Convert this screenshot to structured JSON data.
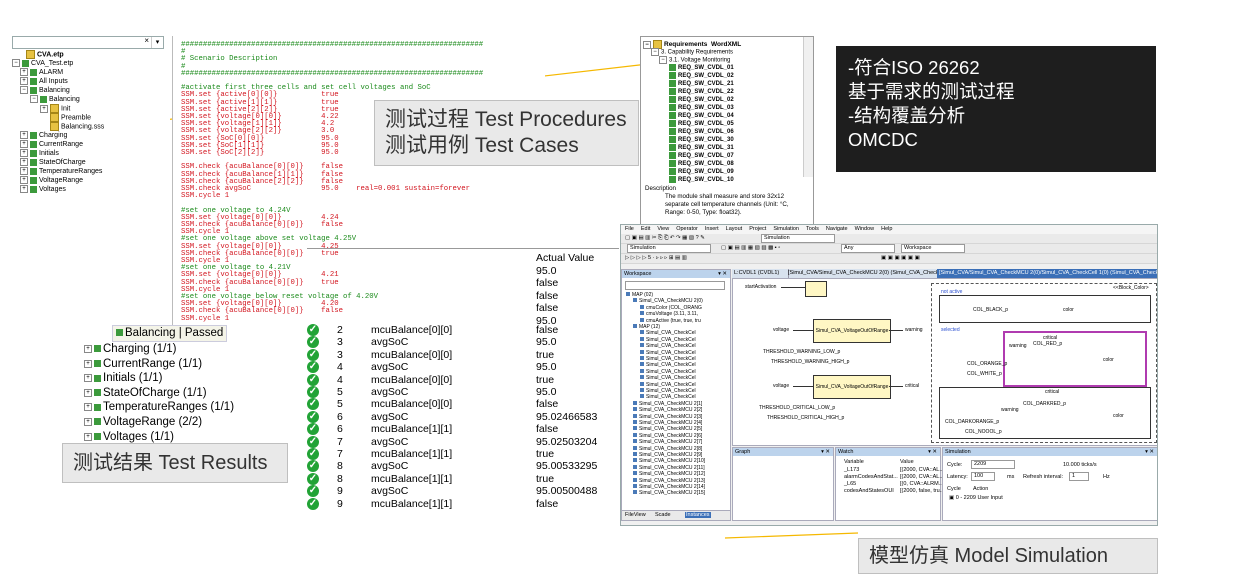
{
  "project_tree": {
    "root": "CVA.etp",
    "test_file": "CVA_Test.etp",
    "items": [
      "ALARM",
      "All Inputs",
      "Balancing",
      "Balancing",
      "Init",
      "Preamble",
      "Balancing.sss",
      "Charging",
      "CurrentRange",
      "Initials",
      "StateOfCharge",
      "TemperatureRanges",
      "VoltageRange",
      "Voltages"
    ]
  },
  "script": {
    "lines": [
      {
        "t": "#####################################################################",
        "c": "sep"
      },
      {
        "t": "#",
        "c": "sep"
      },
      {
        "t": "# Scenario Description",
        "c": "sep"
      },
      {
        "t": "#",
        "c": "sep"
      },
      {
        "t": "#####################################################################",
        "c": "sep"
      },
      {
        "t": "",
        "c": "sep"
      },
      {
        "t": "#activate first three cells and set cell voltages and SoC",
        "c": "sep"
      },
      {
        "t": "SSM.set {active[0][0]}          true",
        "c": "cmd"
      },
      {
        "t": "SSM.set {active[1][1]}          true",
        "c": "cmd"
      },
      {
        "t": "SSM.set {active[2][2]}          true",
        "c": "cmd"
      },
      {
        "t": "SSM.set {voltage[0][0]}         4.22",
        "c": "cmd"
      },
      {
        "t": "SSM.set {voltage[1][1]}         4.2",
        "c": "cmd"
      },
      {
        "t": "SSM.set {voltage[2][2]}         3.0",
        "c": "cmd"
      },
      {
        "t": "SSM.set {SoC[0][0]}             95.0",
        "c": "cmd"
      },
      {
        "t": "SSM.set {SoC[1][1]}             95.0",
        "c": "cmd"
      },
      {
        "t": "SSM.set {SoC[2][2]}             95.0",
        "c": "cmd"
      },
      {
        "t": "",
        "c": "sep"
      },
      {
        "t": "SSM.check {acuBalance[0][0]}    false",
        "c": "cmd"
      },
      {
        "t": "SSM.check {acuBalance[1][1]}    false",
        "c": "cmd"
      },
      {
        "t": "SSM.check {acuBalance[2][2]}    false",
        "c": "cmd"
      },
      {
        "t": "SSM.check avgSoC                95.0    real=0.001 sustain=forever",
        "c": "cmd"
      },
      {
        "t": "SSM.cycle 1",
        "c": "cmd"
      },
      {
        "t": "",
        "c": "sep"
      },
      {
        "t": "#set one voltage to 4.24V",
        "c": "sep"
      },
      {
        "t": "SSM.set {voltage[0][0]}         4.24",
        "c": "cmd"
      },
      {
        "t": "SSM.check {acuBalance[0][0]}    false",
        "c": "cmd"
      },
      {
        "t": "SSM.cycle 1",
        "c": "cmd"
      },
      {
        "t": "#set one voltage above set voltage 4.25V",
        "c": "sep"
      },
      {
        "t": "SSM.set {voltage[0][0]}         4.25",
        "c": "cmd"
      },
      {
        "t": "SSM.check {acuBalance[0][0]}    true",
        "c": "cmd"
      },
      {
        "t": "SSM.cycle 1",
        "c": "cmd"
      },
      {
        "t": "#set one voltage to 4.21V",
        "c": "sep"
      },
      {
        "t": "SSM.set {voltage[0][0]}         4.21",
        "c": "cmd"
      },
      {
        "t": "SSM.check {acuBalance[0][0]}    true",
        "c": "cmd"
      },
      {
        "t": "SSM.cycle 1",
        "c": "cmd"
      },
      {
        "t": "#set one voltage below reset voltage of 4.20V",
        "c": "sep"
      },
      {
        "t": "SSM.set {voltage[0][0]}         4.20",
        "c": "cmd"
      },
      {
        "t": "SSM.check {acuBalance[0][0]}    false",
        "c": "cmd"
      },
      {
        "t": "SSM.cycle 1",
        "c": "cmd"
      }
    ]
  },
  "callouts": {
    "test_procedures": [
      "测试过程 Test Procedures",
      "测试用例 Test Cases"
    ],
    "requirements": [
      "-符合ISO 26262",
      "基于需求的测试过程",
      "-结构覆盖分析",
      "OMCDC"
    ],
    "test_results": "测试结果 Test Results",
    "model_simulation": "模型仿真 Model Simulation"
  },
  "requirements_panel": {
    "header": "Requirements",
    "header2": "WordXML",
    "level1": "3. Capability Requirements",
    "level2": "3.1. Voltage Monitoring",
    "items": [
      "REQ_SW_CVDL_01",
      "REQ_SW_CVDL_02",
      "REQ_SW_CVDL_21",
      "REQ_SW_CVDL_22",
      "REQ_SW_CVDL_02",
      "REQ_SW_CVDL_03",
      "REQ_SW_CVDL_04",
      "REQ_SW_CVDL_05",
      "REQ_SW_CVDL_06",
      "REQ_SW_CVDL_30",
      "REQ_SW_CVDL_31",
      "REQ_SW_CVDL_07",
      "REQ_SW_CVDL_08",
      "REQ_SW_CVDL_09",
      "REQ_SW_CVDL_10"
    ],
    "desc_label": "Description",
    "desc_text": "The module shall measure and store 32x12 separate cell temperature channels (Unit: °C, Range: 0-50, Type: float32)."
  },
  "results_tree": {
    "selected": "Balancing | Passed",
    "items": [
      "Charging (1/1)",
      "CurrentRange (1/1)",
      "Initials (1/1)",
      "StateOfCharge (1/1)",
      "TemperatureRanges (1/1)",
      "VoltageRange (2/2)",
      "Voltages (1/1)"
    ]
  },
  "results_table": {
    "header": "Actual Value",
    "top_values": [
      "95.0",
      "false",
      "false",
      "false",
      "95.0"
    ],
    "rows": [
      {
        "n": "2",
        "var": "mcuBalance[0][0]",
        "val": "false"
      },
      {
        "n": "3",
        "var": "avgSoC",
        "val": "95.0"
      },
      {
        "n": "3",
        "var": "mcuBalance[0][0]",
        "val": "true"
      },
      {
        "n": "4",
        "var": "avgSoC",
        "val": "95.0"
      },
      {
        "n": "4",
        "var": "mcuBalance[0][0]",
        "val": "true"
      },
      {
        "n": "5",
        "var": "avgSoC",
        "val": "95.0"
      },
      {
        "n": "5",
        "var": "mcuBalance[0][0]",
        "val": "false"
      },
      {
        "n": "6",
        "var": "avgSoC",
        "val": "95.02466583"
      },
      {
        "n": "6",
        "var": "mcuBalance[1][1]",
        "val": "false"
      },
      {
        "n": "7",
        "var": "avgSoC",
        "val": "95.02503204"
      },
      {
        "n": "7",
        "var": "mcuBalance[1][1]",
        "val": "true"
      },
      {
        "n": "8",
        "var": "avgSoC",
        "val": "95.00533295"
      },
      {
        "n": "8",
        "var": "mcuBalance[1][1]",
        "val": "true"
      },
      {
        "n": "9",
        "var": "avgSoC",
        "val": "95.00500488"
      },
      {
        "n": "9",
        "var": "mcuBalance[1][1]",
        "val": "false"
      }
    ]
  },
  "ide": {
    "menu": [
      "File",
      "Edit",
      "View",
      "Operator",
      "Insert",
      "Layout",
      "Project",
      "Simulation",
      "Tools",
      "Navigate",
      "Window",
      "Help"
    ],
    "mode": "Simulation",
    "any": "Any",
    "workspace": "Workspace",
    "workspace_title": "Workspace",
    "tabs": [
      "L:CVDL1 (CVDL1)",
      "[Simul_CVA/Simul_CVA_CheckMCU 2(0) (Simul_CVA_CheckMCU 2)]",
      "[Simul_CVA/Simul_CVA_CheckMCU 2(0)/Simul_CVA_CheckCell 1(0) (Simul_CVA_CheckCell 1)]"
    ],
    "tree_items": [
      "MAP (02)",
      "Simul_CVA_CheckMCU 2(0)",
      "cmuColor (COL_ORANG",
      "cmuVoltage (3.11, 3.11,",
      "cmuActive (true, true, tru",
      "MAP (12)",
      "Simul_CVA_CheckCel",
      "Simul_CVA_CheckCel",
      "Simul_CVA_CheckCel",
      "Simul_CVA_CheckCel",
      "Simul_CVA_CheckCel",
      "Simul_CVA_CheckCel",
      "Simul_CVA_CheckCel",
      "Simul_CVA_CheckCel",
      "Simul_CVA_CheckCel",
      "Simul_CVA_CheckCel",
      "Simul_CVA_CheckCel",
      "Simul_CVA_CheckMCU 2[1]",
      "Simul_CVA_CheckMCU 2[2]",
      "Simul_CVA_CheckMCU 2[3]",
      "Simul_CVA_CheckMCU 2[4]",
      "Simul_CVA_CheckMCU 2[5]",
      "Simul_CVA_CheckMCU 2[6]",
      "Simul_CVA_CheckMCU 2[7]",
      "Simul_CVA_CheckMCU 2[8]",
      "Simul_CVA_CheckMCU 2[9]",
      "Simul_CVA_CheckMCU 2[10]",
      "Simul_CVA_CheckMCU 2[11]",
      "Simul_CVA_CheckMCU 2[12]",
      "Simul_CVA_CheckMCU 2[13]",
      "Simul_CVA_CheckMCU 2[14]",
      "Simul_CVA_CheckMCU 2[15]"
    ],
    "bottom_tabs": [
      "FileView",
      "Scade",
      "Instances"
    ],
    "diagram": {
      "start_activation": "startActivation",
      "voltage": "voltage",
      "block1": "Simul_CVA_VoltageOutOfRange",
      "block2": "Simul_CVA_VoltageOutOfRange",
      "warning": "warning",
      "critical": "critical",
      "thr_warn_low": "THRESHOLD_WARNING_LOW_p",
      "thr_warn_high": "THRESHOLD_WARNING_HIGH_p",
      "thr_crit_low": "THRESHOLD_CRITICAL_LOW_p",
      "thr_crit_high": "THRESHOLD_CRITICAL_HIGH_p",
      "not_active": "not active",
      "selected": "selected",
      "col_black": "COL_BLACK_p",
      "color": "color",
      "col_red": "COL_RED_p",
      "col_orange": "COL_ORANGE_p",
      "col_white": "COL_WHITE_p",
      "col_darkred": "COL_DARKRED_p",
      "col_darkorange": "COL_DARKORANGE_p",
      "col_noocol": "COL_NOOOL_p",
      "state_block": "<<Block_Color>"
    },
    "graph_title": "Graph",
    "watch_title": "Watch",
    "watch_cols": [
      "Variable",
      "Value"
    ],
    "watch_rows": [
      {
        "var": "_L173",
        "val": "[(2000, CVA::AL..."
      },
      {
        "var": "alarmCodesAndStat...",
        "val": "[(2000, CVA::AL..."
      },
      {
        "var": "_L65",
        "val": "[(0, CVA::ALRM..."
      },
      {
        "var": "codesAndStatesOUI",
        "val": "[(2000, false, tru..."
      }
    ],
    "sim_title": "Simulation",
    "cycle_label": "Cycle:",
    "cycle_value": "2209",
    "ticks": "10.000 ticks/s",
    "latency_label": "Latency:",
    "latency_value": "100",
    "ms": "ms",
    "refresh_label": "Refresh interval:",
    "refresh_value": "1",
    "hz": "Hz",
    "cycle_col": "Cycle",
    "action_col": "Action",
    "action_row": "0 - 2209 User Input"
  },
  "colors": {
    "callout_dark": "#1e1e1e",
    "callout_light": "#e9e9e9",
    "check": "#22a336",
    "script_green": "#1a8a1a",
    "script_red": "#d2141e",
    "connector": "#f5b800"
  }
}
